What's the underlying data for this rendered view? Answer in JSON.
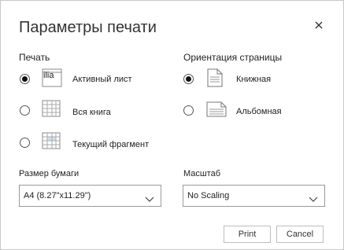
{
  "dialog": {
    "title": "Параметры печати",
    "close_icon": "close-icon"
  },
  "print": {
    "label": "Печать",
    "options": [
      {
        "label": "Активный лист",
        "icon": "active-sheet-icon",
        "icon_text": "ilia",
        "selected": true
      },
      {
        "label": "Вся книга",
        "icon": "workbook-icon",
        "selected": false
      },
      {
        "label": "Текущий фрагмент",
        "icon": "selection-icon",
        "selected": false
      }
    ]
  },
  "orientation": {
    "label": "Ориентация страницы",
    "options": [
      {
        "label": "Книжная",
        "icon": "portrait-page-icon",
        "selected": true
      },
      {
        "label": "Альбомная",
        "icon": "landscape-page-icon",
        "selected": false
      }
    ]
  },
  "paper_size": {
    "label": "Размер бумаги",
    "value": "A4 (8.27\"x11.29\")"
  },
  "scale": {
    "label": "Масштаб",
    "value": "No Scaling"
  },
  "buttons": {
    "print": "Print",
    "cancel": "Cancel"
  }
}
